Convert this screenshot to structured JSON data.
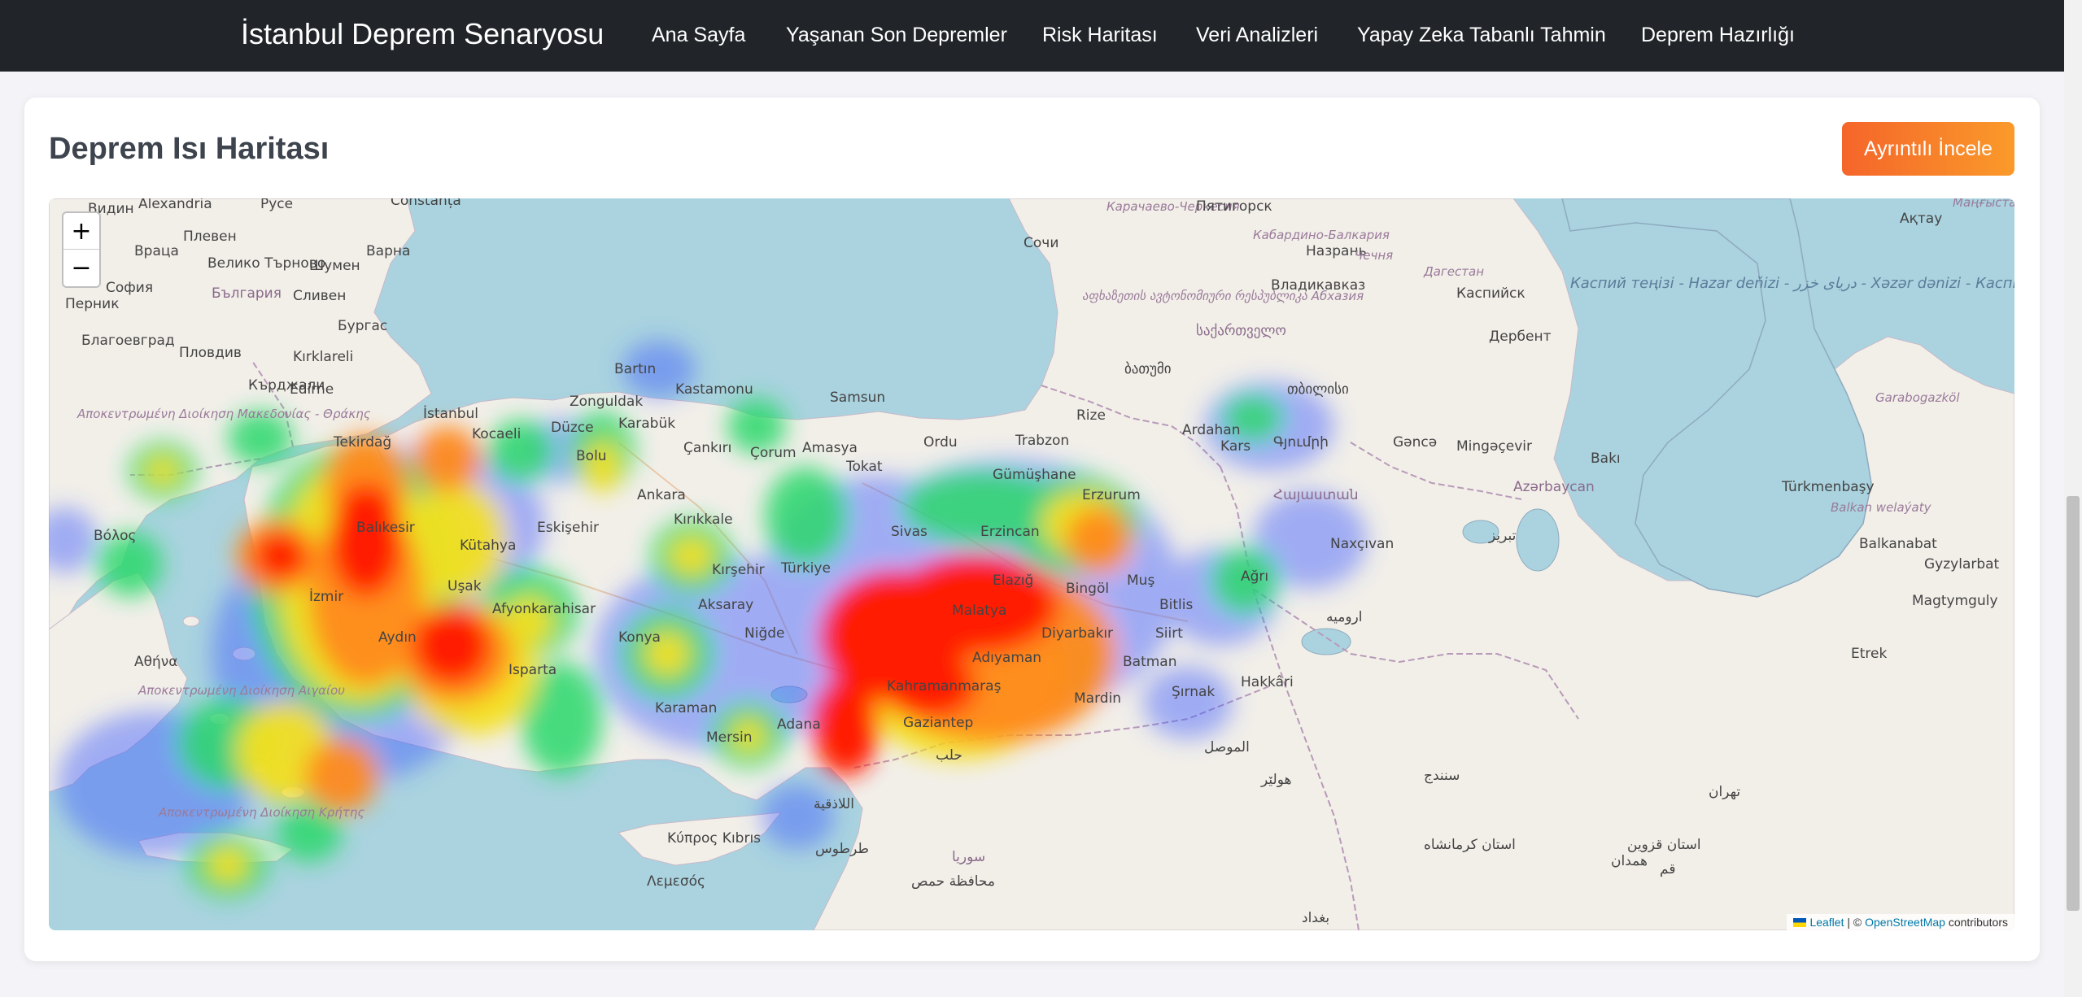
{
  "navbar": {
    "brand": "İstanbul Deprem Senaryosu",
    "links": [
      "Ana Sayfa",
      "Yaşanan Son Depremler",
      "Risk Haritası",
      "Veri Analizleri",
      "Yapay Zeka Tabanlı Tahmin",
      "Deprem Hazırlığı"
    ]
  },
  "card": {
    "title": "Deprem Isı Haritası",
    "button_label": "Ayrıntılı İncele"
  },
  "map": {
    "zoom_in": "+",
    "zoom_out": "−",
    "attribution": {
      "leaflet": "Leaflet",
      "separator": " | © ",
      "osm": "OpenStreetMap",
      "suffix": " contributors"
    },
    "labels": {
      "alexandria": "Alexandria",
      "ruse": "Русе",
      "constanta": "Constanța",
      "vidin": "Видин",
      "vratsa": "Враца",
      "pleven": "Плевен",
      "varna": "Варна",
      "veliko": "Велико Търново",
      "shumen": "Шумен",
      "sofia": "София",
      "bulgaria": "България",
      "sliven": "Сливен",
      "burgas": "Бургас",
      "pernik": "Перник",
      "blagoevgrad": "Благоевград",
      "plovdiv": "Пловдив",
      "kardzhali": "Кърджали",
      "edirne": "Edirne",
      "kirklareli": "Kırklareli",
      "makedonia": "Αποκεντρωμένη Διοίκηση Μακεδονίας - Θράκης",
      "volos": "Βόλος",
      "athina": "Αθήνα",
      "crete_region": "Αποκεντρωμένη Διοίκηση Κρήτης",
      "aegean_region": "Αποκεντρωμένη Διοίκηση Αιγαίου",
      "istanbul": "İstanbul",
      "tekirdag": "Tekirdağ",
      "kocaeli": "Kocaeli",
      "duzce": "Düzce",
      "zonguldak": "Zonguldak",
      "bartin": "Bartın",
      "karabuk": "Karabük",
      "kastamonu": "Kastamonu",
      "cankiri": "Çankırı",
      "samsun": "Samsun",
      "amasya": "Amasya",
      "corum": "Çorum",
      "ordu": "Ordu",
      "trabzon": "Trabzon",
      "rize": "Rize",
      "tokat": "Tokat",
      "ankara": "Ankara",
      "kirikkale": "Kırıkkale",
      "bolu": "Bolu",
      "eskisehir": "Eskişehir",
      "balikesir": "Balıkesir",
      "kutahya": "Kütahya",
      "usak": "Uşak",
      "afyon": "Afyonkarahisar",
      "aydin": "Aydın",
      "izmir": "İzmir",
      "isparta": "Isparta",
      "konya": "Konya",
      "karaman": "Karaman",
      "mersin": "Mersin",
      "adana": "Adana",
      "aksaray": "Aksaray",
      "nigde": "Niğde",
      "kirsehir": "Kırşehir",
      "turkiye": "Türkiye",
      "sivas": "Sivas",
      "erzincan": "Erzincan",
      "erzurum": "Erzurum",
      "gumushane": "Gümüşhane",
      "elazig": "Elazığ",
      "bingol": "Bingöl",
      "mus": "Muş",
      "bitlis": "Bitlis",
      "agri": "Ağrı",
      "kars": "Kars",
      "ardahan": "Ardahan",
      "malatya": "Malatya",
      "adiyaman": "Adıyaman",
      "kahramanmaras": "Kahramanmaraş",
      "gaziantep": "Gaziantep",
      "diyarbakir": "Diyarbakır",
      "batman": "Batman",
      "siirt": "Siirt",
      "mardin": "Mardin",
      "sirnak": "Şırnak",
      "hakkari": "Hakkâri",
      "kibris": "Κύπρος Kıbrıs",
      "lemesos": "Λεμεσός",
      "sochi": "Сочи",
      "karachay": "Карачаево-Черкесия",
      "pyatigorsk": "Пятигорск",
      "kabardino": "Кабардино-Балкария",
      "nazran": "Назрань",
      "chechnya": "Чечня",
      "dagestan": "Дагестан",
      "vladikavkaz": "Владикавказ",
      "abkhazia": "აფხაზეთის ავტონომიური რესპუბლიკა Абхазия",
      "georgia": "საქართველო",
      "batumi": "ბათუმი",
      "tbilisi": "თბილისი",
      "armenia": "Հայաստան",
      "gyumri": "Գյումրի",
      "ganca": "Gəncə",
      "mingacevir": "Mingəçevir",
      "azerbaijan": "Azərbaycan",
      "naxcivan": "Naxçıvan",
      "baki": "Bakı",
      "derbent": "Дербент",
      "kaspiysk": "Каспийск",
      "caspian": "Каспий теңізі - Hazar deňizi - دریای خزر - Xəzər dənizi - Каспийское море - دریای مازندران",
      "turkmenbashy": "Türkmenbaşy",
      "balkan": "Balkan welaýaty",
      "balkanabat": "Balkanabat",
      "gyzylarbat": "Gyzylarbat",
      "magtymguly": "Magtymguly",
      "etrek": "Etrek",
      "garabogaz": "Garabogazköl",
      "aktau": "Ақтау",
      "mangystau": "Маңғыстау облысы",
      "tebriz": "تبریز",
      "urmia": "ارومیه",
      "erbil": "هولێر",
      "mosul": "الموصل",
      "aleppo": "حلب",
      "homs": "محافظة حمص",
      "syria": "سوريا",
      "tartus": "طرطوس",
      "latakia": "اللاذقية",
      "tehran": "تهران",
      "qazvin": "استان قزوین",
      "kermanshah": "استان کرمانشاه",
      "hamadan": "همدان",
      "qom": "قم",
      "sanandaj": "سنندج",
      "baghdad": "بغداد"
    }
  }
}
